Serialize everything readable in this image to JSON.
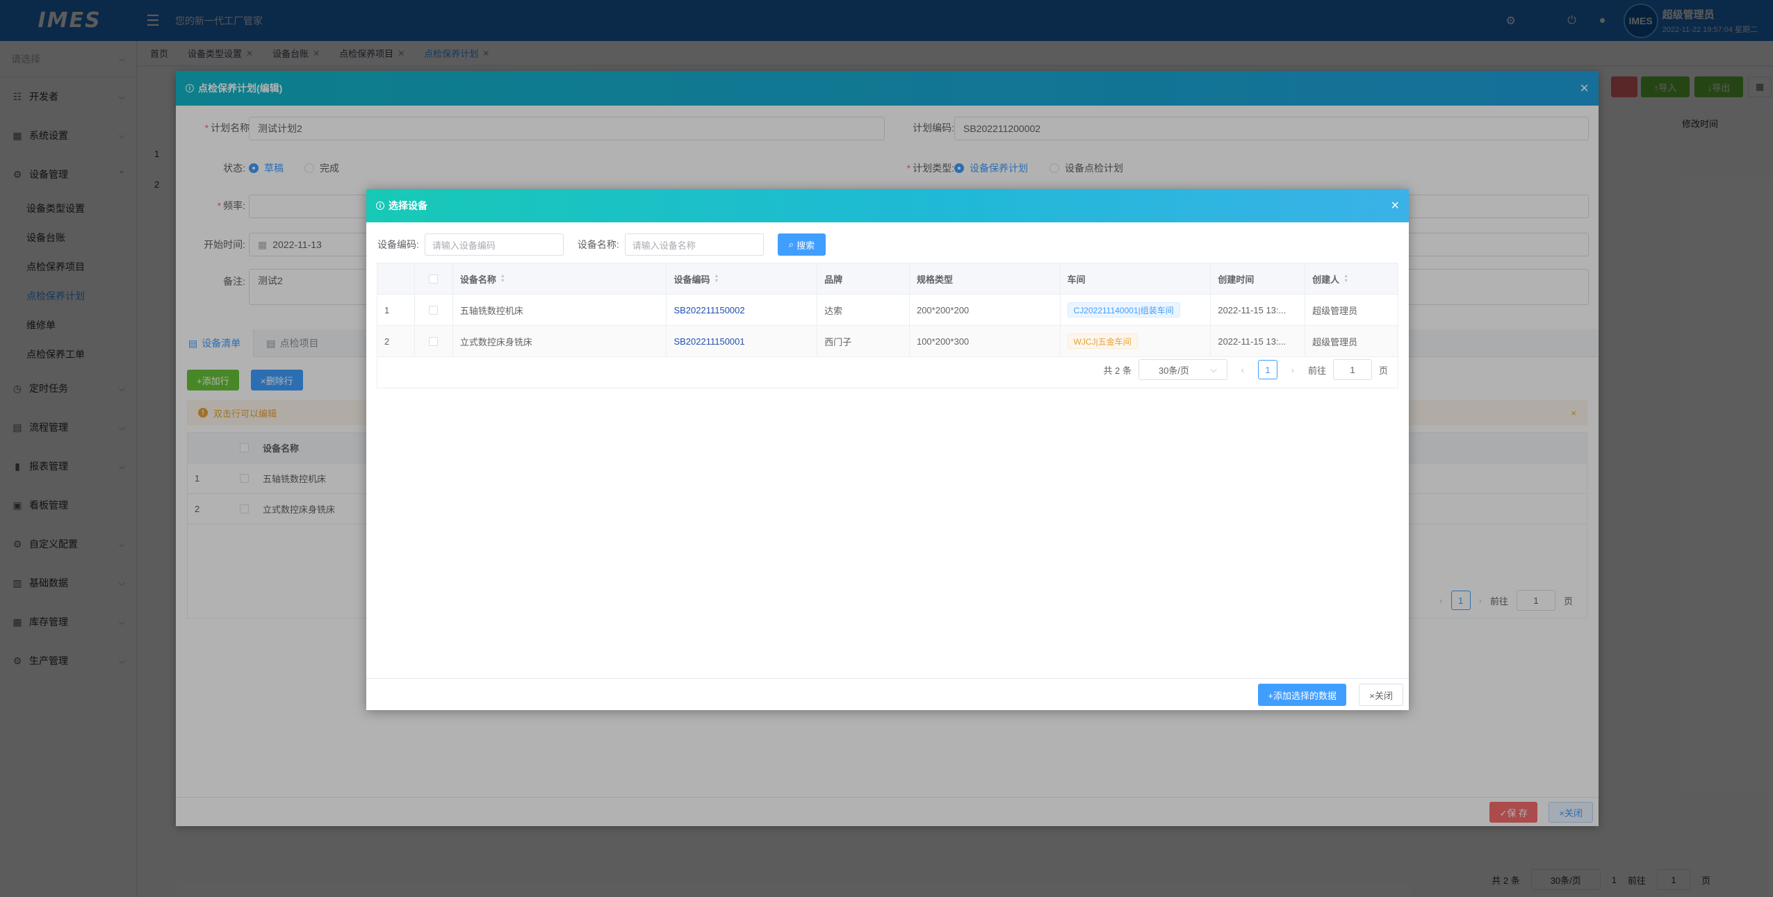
{
  "topbar": {
    "logo": "IMES",
    "slogan": "您的新一代工厂管家",
    "user_name": "超级管理员",
    "user_time": "2022-11-22 19:57:04 星期二",
    "avatar_text": "IMES",
    "icons": [
      "gear-icon",
      "user-icon",
      "power-icon",
      "bell-icon"
    ]
  },
  "sidebar": {
    "system_placeholder": "请选择",
    "menu": [
      {
        "label": "开发者",
        "icon": "sliders-icon"
      },
      {
        "label": "系统设置",
        "icon": "grid-icon"
      },
      {
        "label": "设备管理",
        "icon": "gear-icon"
      }
    ],
    "submenu": [
      "设备类型设置",
      "设备台账",
      "点检保养项目",
      "点检保养计划",
      "维修单",
      "点检保养工单"
    ],
    "active_submenu": "点检保养计划",
    "menu_after": [
      {
        "label": "定时任务",
        "icon": "clock-icon"
      },
      {
        "label": "流程管理",
        "icon": "flow-icon"
      },
      {
        "label": "报表管理",
        "icon": "bar-chart-icon"
      },
      {
        "label": "看板管理",
        "icon": "board-icon"
      },
      {
        "label": "自定义配置",
        "icon": "settings-icon"
      },
      {
        "label": "基础数据",
        "icon": "database-icon"
      },
      {
        "label": "库存管理",
        "icon": "warehouse-icon"
      },
      {
        "label": "生产管理",
        "icon": "cog-icon"
      }
    ]
  },
  "page_tabs": [
    "首页",
    "设备类型设置",
    "设备台账",
    "点检保养项目",
    "点检保养计划"
  ],
  "background": {
    "toolbar_import": "↑导入",
    "toolbar_export": "↓导出",
    "column_modified": "修改时间",
    "row1": "1",
    "row2": "2",
    "footer_total": "共 2 条",
    "footer_size": "30条/页",
    "footer_page": "1",
    "footer_goto": "前往",
    "footer_goto_val": "1",
    "footer_page_unit": "页"
  },
  "plan_dialog": {
    "title": "点检保养计划(编辑)",
    "plan_name_label": "计划名称:",
    "plan_name_value": "测试计划2",
    "plan_code_label": "计划编码:",
    "plan_code_value": "SB202211200002",
    "status_label": "状态:",
    "status_draft": "草稿",
    "status_done": "完成",
    "plan_type_label": "计划类型:",
    "plan_type_maintain": "设备保养计划",
    "plan_type_check": "设备点检计划",
    "frequency_label": "频率:",
    "start_label": "开始时间:",
    "start_value": "2022-11-13",
    "remark_label": "备注:",
    "remark_value": "测试2",
    "tab_equipment": "设备清单",
    "tab_items": "点检项目",
    "add_row": "+添加行",
    "del_row": "×删除行",
    "alert": "双击行可以编辑",
    "table_col_name": "设备名称",
    "rows": [
      {
        "idx": "1",
        "name": "五轴铣数控机床"
      },
      {
        "idx": "2",
        "name": "立式数控床身铣床"
      }
    ],
    "pager_page": "1",
    "pager_goto": "前往",
    "pager_goto_val": "1",
    "pager_unit": "页",
    "save": "✓保 存",
    "close": "×关闭"
  },
  "select_dialog": {
    "title": "选择设备",
    "code_label": "设备编码:",
    "code_placeholder": "请输入设备编码",
    "name_label": "设备名称:",
    "name_placeholder": "请输入设备名称",
    "search_btn": "搜索",
    "columns": [
      "设备名称",
      "设备编码",
      "品牌",
      "规格类型",
      "车间",
      "创建时间",
      "创建人"
    ],
    "rows": [
      {
        "idx": "1",
        "name": "五轴铣数控机床",
        "code": "SB202211150002",
        "brand": "达索",
        "spec": "200*200*200",
        "workshop": "CJ202211140001|组装车间",
        "workshop_color": "blue",
        "created": "2022-11-15 13:...",
        "creator": "超级管理员"
      },
      {
        "idx": "2",
        "name": "立式数控床身铣床",
        "code": "SB202211150001",
        "brand": "西门子",
        "spec": "100*200*300",
        "workshop": "WJCJ|五金车间",
        "workshop_color": "orange",
        "created": "2022-11-15 13:...",
        "creator": "超级管理员"
      }
    ],
    "pager_total": "共 2 条",
    "pager_size": "30条/页",
    "pager_page": "1",
    "pager_goto": "前往",
    "pager_goto_val": "1",
    "pager_unit": "页",
    "add_selected": "+添加选择的数据",
    "close": "×关闭"
  },
  "colors": {
    "topbar": "#1f72c8",
    "primary": "#409eff",
    "success": "#67c23a",
    "danger": "#f56c6c",
    "warning": "#e6a23c"
  }
}
